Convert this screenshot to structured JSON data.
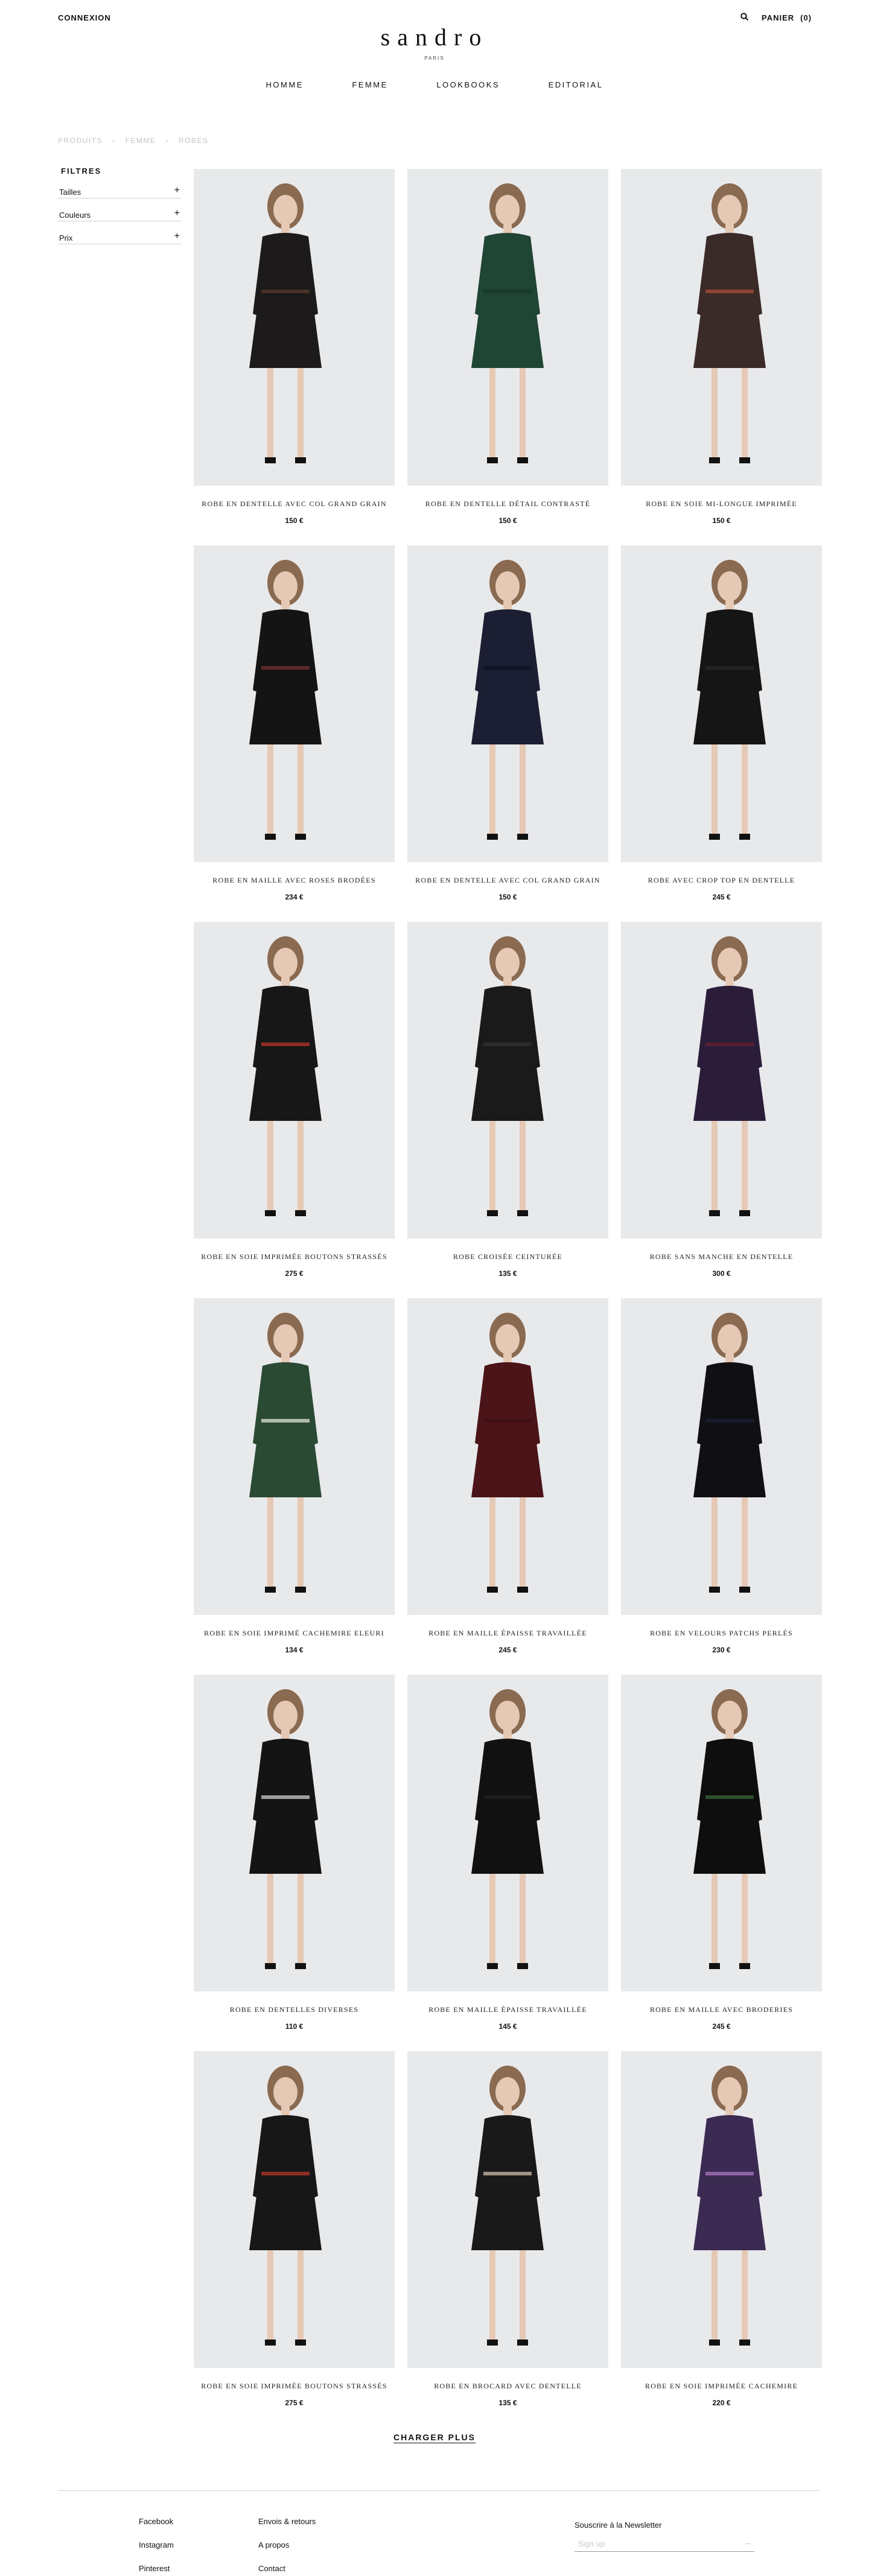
{
  "header": {
    "login_label": "CONNEXION",
    "logo": "sandro",
    "logo_subtitle": "PARIS",
    "cart_label": "PANIER",
    "cart_count": "(0)"
  },
  "nav": {
    "items": [
      "HOMME",
      "FEMME",
      "LOOKBOOKS",
      "EDITORIAL"
    ]
  },
  "breadcrumb": [
    "PRODUITS",
    "FEMME",
    "ROBES"
  ],
  "filters": {
    "title": "FILTRES",
    "items": [
      "Tailles",
      "Couleurs",
      "Prix"
    ],
    "expand_symbol": "+"
  },
  "products": [
    {
      "name": "ROBE EN DENTELLE AVEC COL GRAND GRAIN",
      "price": "150 €"
    },
    {
      "name": "ROBE EN DENTELLE DÉTAIL CONTRASTÉ",
      "price": "150 €"
    },
    {
      "name": "ROBE EN SOIE MI-LONGUE IMPRIMÉE",
      "price": "150 €"
    },
    {
      "name": "ROBE EN MAILLE AVEC ROSES BRODÉES",
      "price": "234 €"
    },
    {
      "name": "ROBE EN DENTELLE AVEC COL GRAND GRAIN",
      "price": "150 €"
    },
    {
      "name": "ROBE AVEC CROP TOP EN DENTELLE",
      "price": "245 €"
    },
    {
      "name": "ROBE EN SOIE IMPRIMÉE BOUTONS STRASSÉS",
      "price": "275 €"
    },
    {
      "name": "ROBE CROISÉE CEINTURÉE",
      "price": "135 €"
    },
    {
      "name": "ROBE SANS MANCHE EN DENTELLE",
      "price": "300 €"
    },
    {
      "name": "ROBE EN SOIE IMPRIMÉ CACHEMIRE ELEURI",
      "price": "134 €"
    },
    {
      "name": "ROBE EN MAILLE ÉPAISSE TRAVAILLÉE",
      "price": "245 €"
    },
    {
      "name": "ROBE EN VELOURS PATCHS PERLÉS",
      "price": "230 €"
    },
    {
      "name": "ROBE EN DENTELLES DIVERSES",
      "price": "110 €"
    },
    {
      "name": "ROBE EN MAILLE ÉPAISSE TRAVAILLÉE",
      "price": "145 €"
    },
    {
      "name": "ROBE EN MAILLE AVEC BRODERIES",
      "price": "245 €"
    },
    {
      "name": "ROBE EN SOIE IMPRIMÉE BOUTONS STRASSÉS",
      "price": "275 €"
    },
    {
      "name": "ROBE EN BROCARD AVEC DENTELLE",
      "price": "135 €"
    },
    {
      "name": "ROBE EN SOIE IMPRIMÉE CACHEMIRE",
      "price": "220 €"
    }
  ],
  "photos": [
    {
      "dress": "#1c1a1a",
      "accent": "#5a3a2a"
    },
    {
      "dress": "#1f4535",
      "accent": "#16352a"
    },
    {
      "dress": "#3a2a28",
      "accent": "#b0503a"
    },
    {
      "dress": "#141414",
      "accent": "#7a3030"
    },
    {
      "dress": "#1c1f33",
      "accent": "#0d0f1e"
    },
    {
      "dress": "#151515",
      "accent": "#2a2a2a"
    },
    {
      "dress": "#171717",
      "accent": "#c0392b"
    },
    {
      "dress": "#1a1a1a",
      "accent": "#333333"
    },
    {
      "dress": "#2b1d3a",
      "accent": "#6a1f2a"
    },
    {
      "dress": "#2a4a34",
      "accent": "#e8e8e0"
    },
    {
      "dress": "#4a1418",
      "accent": "#3a0f12"
    },
    {
      "dress": "#101014",
      "accent": "#1c2238"
    },
    {
      "dress": "#141414",
      "accent": "#d8d8d8"
    },
    {
      "dress": "#111111",
      "accent": "#222222"
    },
    {
      "dress": "#0e0e0e",
      "accent": "#3a6a3a"
    },
    {
      "dress": "#171717",
      "accent": "#c0392b"
    },
    {
      "dress": "#191919",
      "accent": "#d9c8b0"
    },
    {
      "dress": "#3b2a52",
      "accent": "#b07ac8"
    }
  ],
  "load_more": "CHARGER PLUS",
  "footer": {
    "col1": [
      "Facebook",
      "Instagram",
      "Pinterest"
    ],
    "col2": [
      "Envois & retours",
      "A propos",
      "Contact"
    ],
    "newsletter_title": "Souscrire à la Newsletter",
    "newsletter_placeholder": "Sign up",
    "newsletter_arrow": "→"
  }
}
